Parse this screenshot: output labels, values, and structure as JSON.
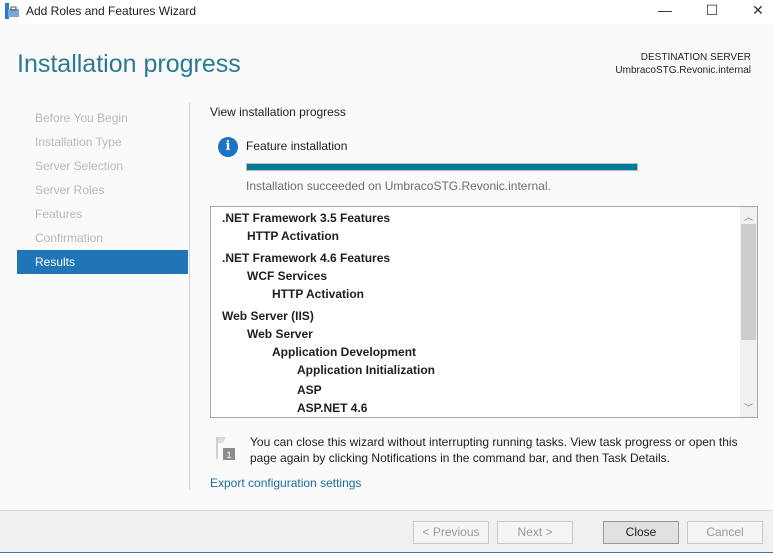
{
  "window": {
    "title": "Add Roles and Features Wizard",
    "minimize": "—",
    "maximize": "☐",
    "close": "✕"
  },
  "header": {
    "title": "Installation progress",
    "destination_label": "DESTINATION SERVER",
    "destination_server": "UmbracoSTG.Revonic.internal"
  },
  "nav": [
    {
      "label": "Before You Begin",
      "active": false
    },
    {
      "label": "Installation Type",
      "active": false
    },
    {
      "label": "Server Selection",
      "active": false
    },
    {
      "label": "Server Roles",
      "active": false
    },
    {
      "label": "Features",
      "active": false
    },
    {
      "label": "Confirmation",
      "active": false
    },
    {
      "label": "Results",
      "active": true
    }
  ],
  "main": {
    "subtitle": "View installation progress",
    "info_icon": "info-icon",
    "feature_label": "Feature installation",
    "progress_percent": 100,
    "progress_color": "#007a9a",
    "status": "Installation succeeded on UmbracoSTG.Revonic.internal.",
    "features": [
      {
        "label": ".NET Framework 3.5 Features",
        "level": 0
      },
      {
        "label": "HTTP Activation",
        "level": 1
      },
      {
        "label": ".NET Framework 4.6 Features",
        "level": 0
      },
      {
        "label": "WCF Services",
        "level": 1
      },
      {
        "label": "HTTP Activation",
        "level": 2
      },
      {
        "label": "Web Server (IIS)",
        "level": 0
      },
      {
        "label": "Web Server",
        "level": 1
      },
      {
        "label": "Application Development",
        "level": 2
      },
      {
        "label": "Application Initialization",
        "level": 3
      },
      {
        "label": "ASP",
        "level": 3
      },
      {
        "label": "ASP.NET 4.6",
        "level": 3
      }
    ],
    "note": "You can close this wizard without interrupting running tasks. View task progress or open this page again by clicking Notifications in the command bar, and then Task Details.",
    "note_badge": "1",
    "export_link": "Export configuration settings"
  },
  "footer": {
    "previous": "< Previous",
    "next": "Next >",
    "close": "Close",
    "cancel": "Cancel"
  },
  "accent_color": "#1f75b8"
}
